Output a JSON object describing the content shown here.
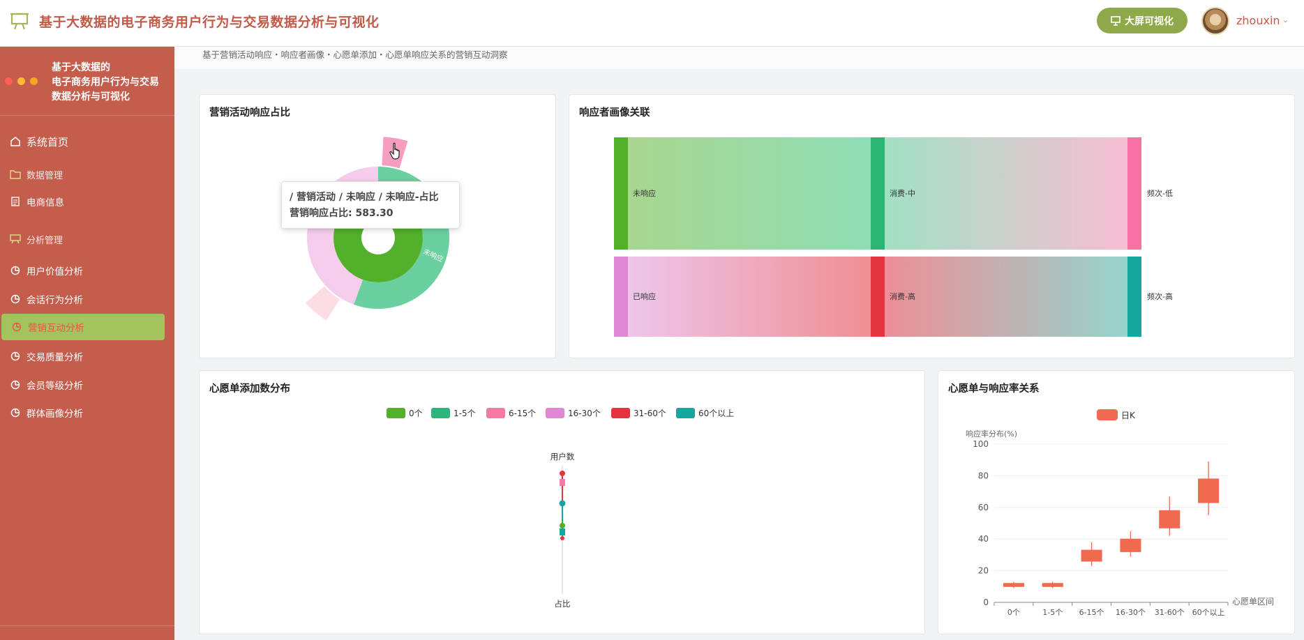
{
  "header": {
    "title": "基于大数据的电子商务用户行为与交易数据分析与可视化",
    "bigscreen_label": "大屏可视化",
    "username": "zhouxin",
    "logo_icon": "presentation-board-icon",
    "title_color": "#c25a48"
  },
  "sidebar": {
    "brand_line1": "基于大数据的",
    "brand_line2": "电子商务用户行为与交易",
    "brand_line3": "数据分析与可视化",
    "window_dots": [
      "#ff5f57",
      "#febc2e",
      "#f5a623"
    ],
    "home": "系统首页",
    "group_data": "数据管理",
    "ecommerce": "电商信息",
    "group_analysis": "分析管理",
    "items": [
      "用户价值分析",
      "会话行为分析",
      "营销互动分析",
      "交易质量分析",
      "会员等级分析",
      "群体画像分析"
    ],
    "active_index": 2,
    "bg_color": "#c45d4c",
    "active_color": "#a3c45c"
  },
  "breadcrumb": "基于营销活动响应・响应者画像・心愿单添加・心愿单响应关系的营销互动洞察",
  "cards": {
    "sunburst_title": "营销活动响应占比",
    "sankey_title": "响应者画像关联",
    "wishlist_title": "心愿单添加数分布",
    "relation_title": "心愿单与响应率关系"
  },
  "tooltip": {
    "line1": "/ 营销活动 / 未响应 / 未响应-占比",
    "line2_label": "营销响应占比:",
    "line2_value": "583.30"
  },
  "sunburst": {
    "segment_labels": [
      "未响应",
      "未响应"
    ]
  },
  "sankey": {
    "nodes": [
      "未响应",
      "已响应",
      "消费-中",
      "消费-高",
      "频次-低",
      "频次-高"
    ]
  },
  "wishlist_chart": {
    "legend": [
      "0个",
      "1-5个",
      "6-15个",
      "16-30个",
      "31-60个",
      "60个以上"
    ],
    "legend_colors": [
      "#52b02a",
      "#2fb57a",
      "#f57aa6",
      "#de87d2",
      "#e2353f",
      "#17a69e"
    ],
    "axis_top_label": "用户数",
    "axis_bottom_label": "占比"
  },
  "chart_data": {
    "type": "candlestick",
    "legend": "日K",
    "ylabel": "响应率分布(%)",
    "xlabel": "心愿单区间",
    "ylim": [
      0,
      100
    ],
    "yticks": [
      0,
      20,
      40,
      60,
      80,
      100
    ],
    "categories": [
      "0个",
      "1-5个",
      "6-15个",
      "16-30个",
      "31-60个",
      "60个以上"
    ],
    "series": [
      {
        "open": 10,
        "close": 12,
        "low": 9,
        "high": 13
      },
      {
        "open": 10,
        "close": 12,
        "low": 9,
        "high": 13
      },
      {
        "open": 26,
        "close": 33,
        "low": 23,
        "high": 38
      },
      {
        "open": 32,
        "close": 40,
        "low": 29,
        "high": 45
      },
      {
        "open": 47,
        "close": 58,
        "low": 42,
        "high": 67
      },
      {
        "open": 63,
        "close": 78,
        "low": 55,
        "high": 89
      }
    ],
    "color": "#ef6a4f"
  }
}
